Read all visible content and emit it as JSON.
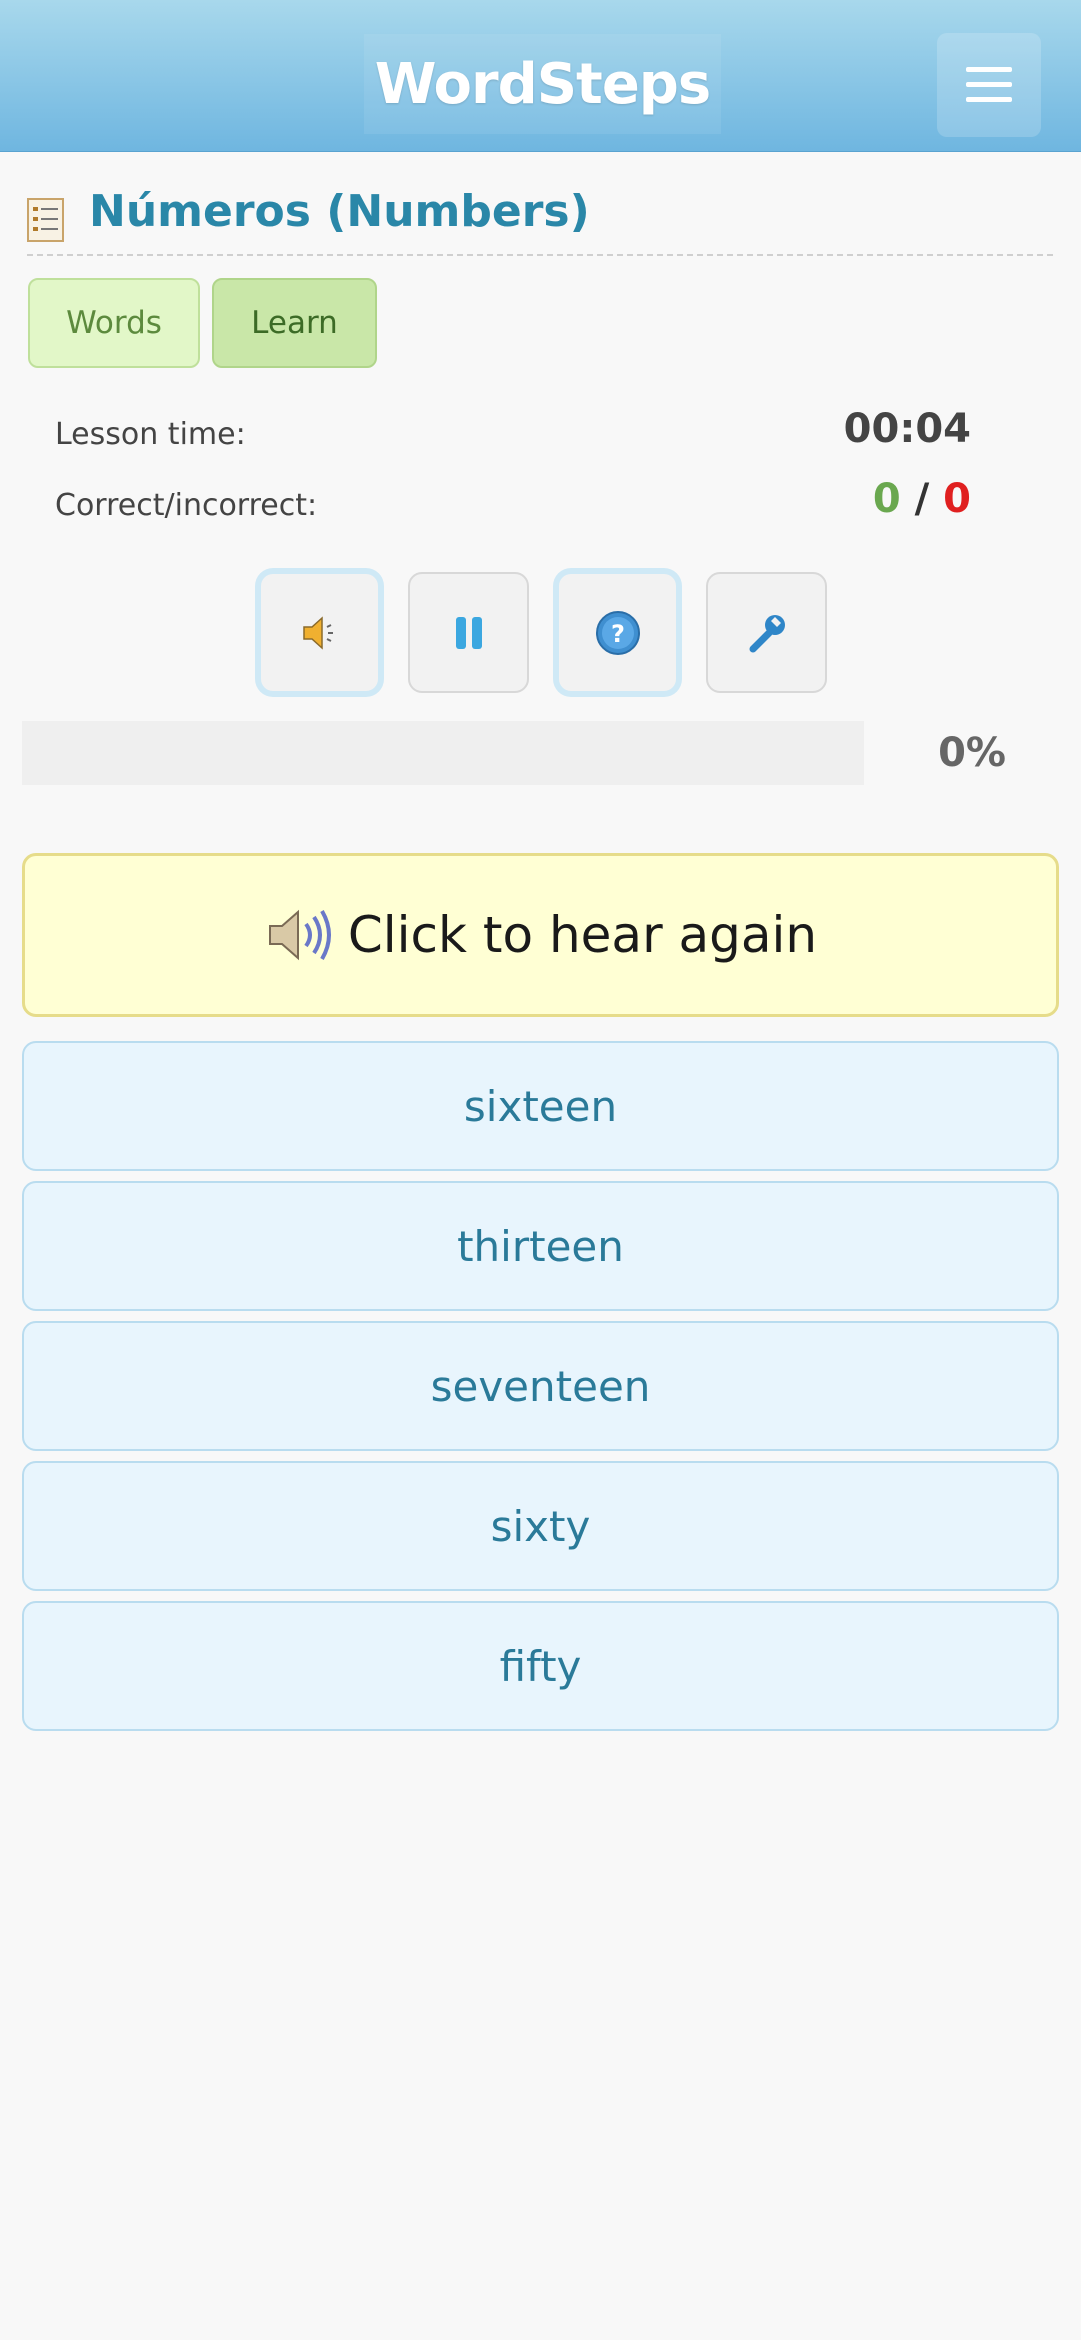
{
  "header": {
    "logo": "WordSteps",
    "menu_icon": "hamburger-menu-icon"
  },
  "lesson": {
    "title": "Números (Numbers)",
    "title_icon": "list-icon"
  },
  "tabs": [
    {
      "label": "Words"
    },
    {
      "label": "Learn"
    }
  ],
  "stats": {
    "time_label": "Lesson time:",
    "time_value": "00:04",
    "score_label": "Correct/incorrect:",
    "correct": "0",
    "separator": "/",
    "incorrect": "0"
  },
  "controls": [
    "speaker-icon",
    "pause-icon",
    "help-icon",
    "settings-wrench-icon"
  ],
  "progress": {
    "fraction": 0.0,
    "label": "0%"
  },
  "prompt": {
    "label": "Click to hear again",
    "icon": "speaker-volume-icon"
  },
  "answers": [
    "sixteen",
    "thirteen",
    "seventeen",
    "sixty",
    "fifty"
  ],
  "colors": {
    "header": "#6fb6e0",
    "title": "#2a87a8",
    "correct": "#6aa84f",
    "incorrect": "#e02020",
    "answer_bg": "#e8f5fd",
    "prompt_bg": "#ffffd4"
  }
}
